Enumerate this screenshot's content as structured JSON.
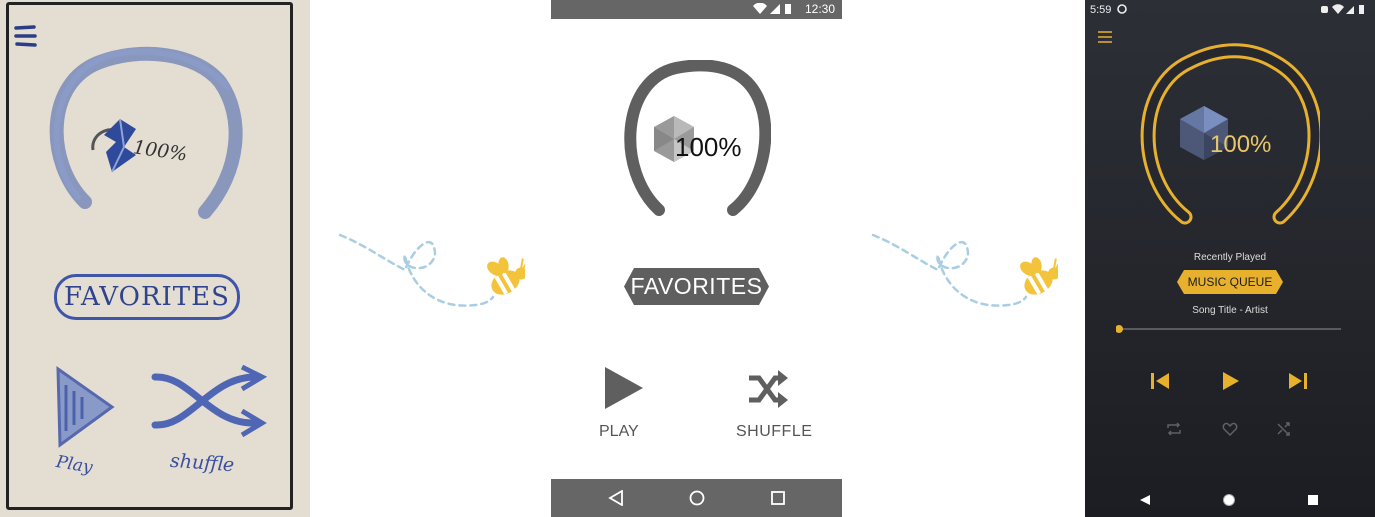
{
  "sketch": {
    "percent_label": "100%",
    "favorites_label": "FAVORITES",
    "play_label": "Play",
    "shuffle_label": "shuffle"
  },
  "wireframe": {
    "status_time": "12:30",
    "percent_label": "100%",
    "favorites_label": "FAVORITES",
    "play_label": "PLAY",
    "shuffle_label": "SHUFFLE",
    "nav_icons": [
      "back-icon",
      "home-icon",
      "recents-icon"
    ]
  },
  "app": {
    "status_time": "5:59",
    "percent_label": "100%",
    "recently_played_label": "Recently Played",
    "music_queue_label": "MUSIC QUEUE",
    "song_label": "Song Title - Artist",
    "progress": 0,
    "controls": [
      "skip-previous-icon",
      "play-icon",
      "skip-next-icon"
    ],
    "secondary_controls": [
      "repeat-icon",
      "heart-icon",
      "shuffle-icon"
    ]
  },
  "colors": {
    "sketch_blue": "#3f55a8",
    "wire_gray": "#5f5f5f",
    "app_gold": "#e7b12e",
    "app_bg": "#26282e",
    "bee_yellow": "#f2c33b",
    "trail_blue": "#a9cde2"
  }
}
